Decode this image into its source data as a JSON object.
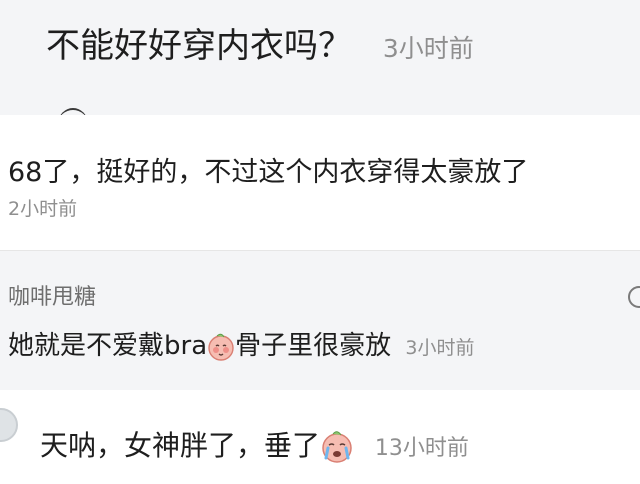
{
  "top_comment": {
    "text": "不能好好穿内衣吗？",
    "time": "3小时前"
  },
  "reply_1": {
    "text": "68了，挺好的，不过这个内衣穿得太豪放了",
    "time": "2小时前"
  },
  "reply_2": {
    "author": "咖啡甩糖",
    "text_before": "她就是不爱戴bra",
    "emoji": "blushing-face-emoji",
    "text_after": "骨子里很豪放",
    "time": "3小时前"
  },
  "reply_3": {
    "text": "天呐，女神胖了，垂了",
    "emoji": "crying-face-emoji",
    "time": "13小时前"
  },
  "colors": {
    "page_gray": "#f4f5f7",
    "muted_text": "#8f8f8f",
    "emoji_pink": "#f5b0a6"
  }
}
